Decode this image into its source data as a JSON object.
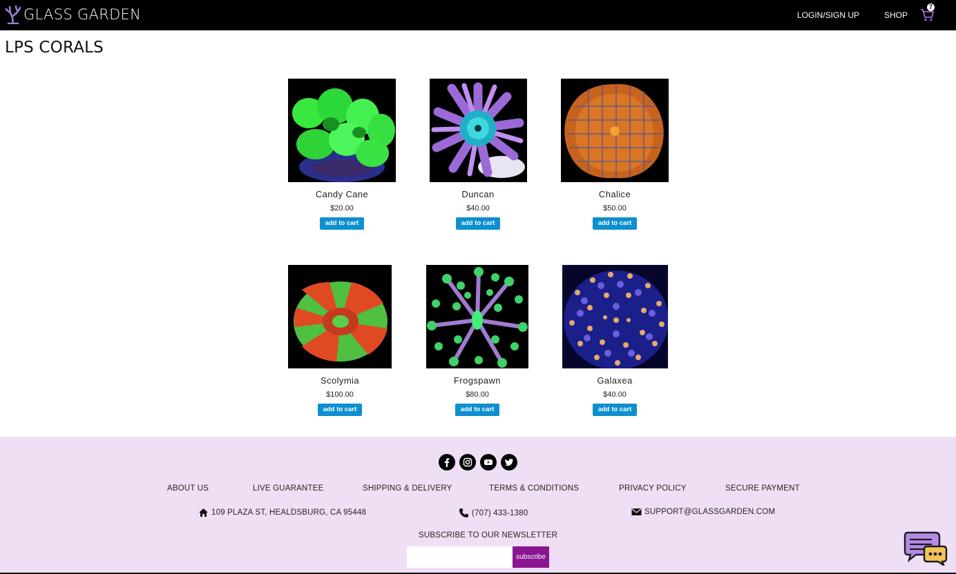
{
  "header": {
    "brand": "GLASS GARDEN",
    "nav": {
      "login": "LOGIN/SIGN UP",
      "shop": "SHOP"
    },
    "cart_count": "7"
  },
  "page": {
    "title": "LPS CORALS"
  },
  "products": [
    {
      "name": "Candy Cane",
      "price": "$20.00",
      "button": "add to cart"
    },
    {
      "name": "Duncan",
      "price": "$40.00",
      "button": "add to cart"
    },
    {
      "name": "Chalice",
      "price": "$50.00",
      "button": "add to cart"
    },
    {
      "name": "Scolymia",
      "price": "$100.00",
      "button": "add to cart"
    },
    {
      "name": "Frogspawn",
      "price": "$80.00",
      "button": "add to cart"
    },
    {
      "name": "Galaxea",
      "price": "$40.00",
      "button": "add to cart"
    }
  ],
  "footer": {
    "socials": [
      "facebook-icon",
      "instagram-icon",
      "youtube-icon",
      "twitter-icon"
    ],
    "links": [
      "ABOUT US",
      "LIVE GUARANTEE",
      "SHIPPING & DELIVERY",
      "TERMS & CONDITIONS",
      "PRIVACY POLICY",
      "SECURE PAYMENT"
    ],
    "address": "109 PLAZA ST, HEALDSBURG, CA 95448",
    "phone": "(707) 433-1380",
    "email": "SUPPORT@GLASSGARDEN.COM",
    "newsletter_label": "SUBSCRIBE TO OUR NEWSLETTER",
    "newsletter_placeholder": "",
    "subscribe_button": "subscribe"
  },
  "colors": {
    "header_bg": "#000000",
    "footer_bg": "#efdff5",
    "button_blue": "#0e8fcf",
    "subscribe_purple": "#8a1591"
  }
}
